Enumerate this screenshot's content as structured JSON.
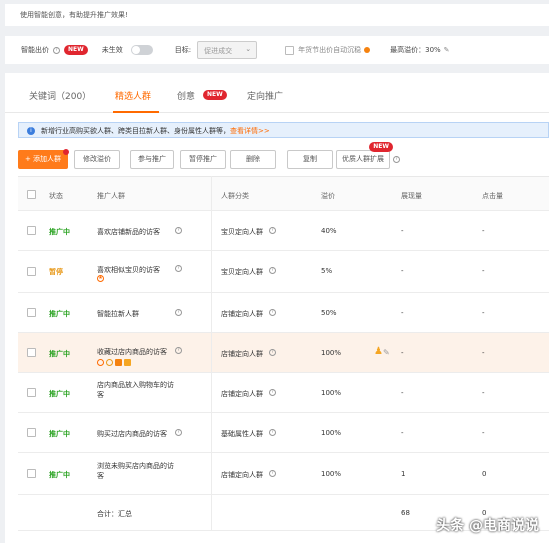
{
  "tip": "使用智能创意，有助提升推广效果!",
  "settings": {
    "smart_bid_label": "智能出价",
    "new_badge": "NEW",
    "status": "未生效",
    "goal_label": "目标:",
    "goal_value": "促进成交",
    "festival_label": "年货节出价自动沉稳",
    "max_premium": "最高溢价：30%"
  },
  "tabs": [
    {
      "label": "关键词（200）"
    },
    {
      "label": "精选人群"
    },
    {
      "label": "创意"
    },
    {
      "label": "定向推广"
    }
  ],
  "info": {
    "text": "新增行业高购买欲人群、跨类目拉新人群、身份属性人群等，",
    "link": "查看详情>>"
  },
  "toolbar": {
    "add": "+ 添加人群",
    "modify": "修改溢价",
    "join": "参与推广",
    "pause": "暂停推广",
    "delete": "删除",
    "copy": "复制",
    "expand": "优质人群扩展",
    "expand_badge": "NEW"
  },
  "table": {
    "headers": [
      "状态",
      "推广人群",
      "人群分类",
      "溢价",
      "展现量",
      "点击量"
    ],
    "rows": [
      {
        "status": "推广中",
        "name": "喜欢店铺新品的访客",
        "category": "宝贝定向人群",
        "premium": "40%",
        "impressions": "-",
        "clicks": "-"
      },
      {
        "status": "暂停",
        "name": "喜欢相似宝贝的访客",
        "category": "宝贝定向人群",
        "premium": "5%",
        "impressions": "-",
        "clicks": "-"
      },
      {
        "status": "推广中",
        "name": "智能拉新人群",
        "category": "店铺定向人群",
        "premium": "50%",
        "impressions": "-",
        "clicks": "-"
      },
      {
        "status": "推广中",
        "name": "收藏过店内商品的访客",
        "category": "店铺定向人群",
        "premium": "100%",
        "impressions": "-",
        "clicks": "-"
      },
      {
        "status": "推广中",
        "name": "店内商品放入购物车的访客",
        "category": "店铺定向人群",
        "premium": "100%",
        "impressions": "-",
        "clicks": "-"
      },
      {
        "status": "推广中",
        "name": "购买过店内商品的访客",
        "category": "基础属性人群",
        "premium": "100%",
        "impressions": "-",
        "clicks": "-"
      },
      {
        "status": "推广中",
        "name": "浏览未购买店内商品的访客",
        "category": "店铺定向人群",
        "premium": "100%",
        "impressions": "1",
        "clicks": "0"
      }
    ],
    "total_label": "合计：汇总",
    "total_impressions": "68",
    "total_clicks": "0"
  },
  "watermark": "头条 @电商说说"
}
